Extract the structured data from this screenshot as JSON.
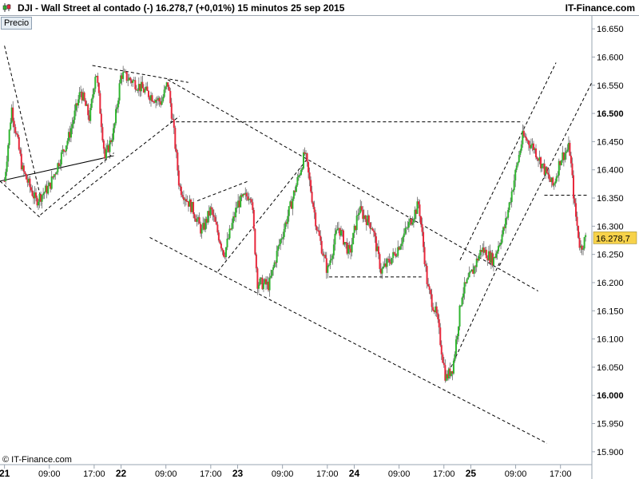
{
  "header": {
    "title": "DJI - Wall Street al contado (-)    16.278,7 (+0,01%)    15 minutos  25 sep 2015",
    "brand": "IT-Finance.com",
    "icon": "candlestick-icon"
  },
  "chart_label": "Precio",
  "watermark": "© IT-Finance.com",
  "colors": {
    "up": "#2fb52f",
    "down": "#e8283c",
    "price_tag": "#f7d24a",
    "axis": "#9aa4b0"
  },
  "chart_data": {
    "type": "candlestick",
    "interval": "15 minutos",
    "last_price_label": "16.278,7",
    "last_price": 16278.7,
    "ylim": [
      15880,
      16670
    ],
    "yticks": [
      {
        "value": 16650,
        "label": "16.650"
      },
      {
        "value": 16600,
        "label": "16.600"
      },
      {
        "value": 16550,
        "label": "16.550"
      },
      {
        "value": 16500,
        "label": "16.500",
        "bold": true
      },
      {
        "value": 16450,
        "label": "16.450"
      },
      {
        "value": 16400,
        "label": "16.400"
      },
      {
        "value": 16350,
        "label": "16.350"
      },
      {
        "value": 16300,
        "label": "16.300"
      },
      {
        "value": 16250,
        "label": "16.250"
      },
      {
        "value": 16200,
        "label": "16.200"
      },
      {
        "value": 16150,
        "label": "16.150"
      },
      {
        "value": 16100,
        "label": "16.100"
      },
      {
        "value": 16050,
        "label": "16.050"
      },
      {
        "value": 16000,
        "label": "16.000",
        "bold": true
      },
      {
        "value": 15950,
        "label": "15.950"
      },
      {
        "value": 15900,
        "label": "15.900"
      }
    ],
    "xticks": [
      {
        "t": 0,
        "label": "21",
        "bold": true
      },
      {
        "t": 0.5,
        "label": "09:00"
      },
      {
        "t": 1.0,
        "label": "17:00"
      },
      {
        "t": 1.3,
        "label": "22",
        "bold": true
      },
      {
        "t": 1.8,
        "label": "09:00"
      },
      {
        "t": 2.3,
        "label": "17:00"
      },
      {
        "t": 2.6,
        "label": "23",
        "bold": true
      },
      {
        "t": 3.1,
        "label": "09:00"
      },
      {
        "t": 3.6,
        "label": "17:00"
      },
      {
        "t": 3.9,
        "label": "24",
        "bold": true
      },
      {
        "t": 4.4,
        "label": "09:00"
      },
      {
        "t": 4.9,
        "label": "17:00"
      },
      {
        "t": 5.2,
        "label": "25",
        "bold": true
      },
      {
        "t": 5.7,
        "label": "09:00"
      },
      {
        "t": 6.2,
        "label": "17:00"
      }
    ],
    "xlim": [
      -0.05,
      6.55
    ],
    "price_path": [
      {
        "t": 0.0,
        "p": 16380
      },
      {
        "t": 0.08,
        "p": 16510
      },
      {
        "t": 0.2,
        "p": 16400
      },
      {
        "t": 0.35,
        "p": 16345
      },
      {
        "t": 0.5,
        "p": 16370
      },
      {
        "t": 0.62,
        "p": 16420
      },
      {
        "t": 0.72,
        "p": 16460
      },
      {
        "t": 0.85,
        "p": 16540
      },
      {
        "t": 0.95,
        "p": 16490
      },
      {
        "t": 1.02,
        "p": 16580
      },
      {
        "t": 1.12,
        "p": 16420
      },
      {
        "t": 1.22,
        "p": 16470
      },
      {
        "t": 1.3,
        "p": 16570
      },
      {
        "t": 1.45,
        "p": 16555
      },
      {
        "t": 1.6,
        "p": 16535
      },
      {
        "t": 1.75,
        "p": 16520
      },
      {
        "t": 1.82,
        "p": 16555
      },
      {
        "t": 1.88,
        "p": 16480
      },
      {
        "t": 1.95,
        "p": 16370
      },
      {
        "t": 2.1,
        "p": 16330
      },
      {
        "t": 2.2,
        "p": 16290
      },
      {
        "t": 2.3,
        "p": 16330
      },
      {
        "t": 2.45,
        "p": 16250
      },
      {
        "t": 2.6,
        "p": 16340
      },
      {
        "t": 2.75,
        "p": 16360
      },
      {
        "t": 2.82,
        "p": 16200
      },
      {
        "t": 2.95,
        "p": 16195
      },
      {
        "t": 3.05,
        "p": 16260
      },
      {
        "t": 3.18,
        "p": 16330
      },
      {
        "t": 3.35,
        "p": 16430
      },
      {
        "t": 3.48,
        "p": 16300
      },
      {
        "t": 3.6,
        "p": 16220
      },
      {
        "t": 3.72,
        "p": 16300
      },
      {
        "t": 3.85,
        "p": 16250
      },
      {
        "t": 3.95,
        "p": 16330
      },
      {
        "t": 4.1,
        "p": 16300
      },
      {
        "t": 4.2,
        "p": 16220
      },
      {
        "t": 4.35,
        "p": 16250
      },
      {
        "t": 4.5,
        "p": 16300
      },
      {
        "t": 4.62,
        "p": 16340
      },
      {
        "t": 4.72,
        "p": 16190
      },
      {
        "t": 4.82,
        "p": 16140
      },
      {
        "t": 4.92,
        "p": 16030
      },
      {
        "t": 5.0,
        "p": 16050
      },
      {
        "t": 5.1,
        "p": 16180
      },
      {
        "t": 5.22,
        "p": 16220
      },
      {
        "t": 5.32,
        "p": 16260
      },
      {
        "t": 5.45,
        "p": 16240
      },
      {
        "t": 5.58,
        "p": 16300
      },
      {
        "t": 5.68,
        "p": 16380
      },
      {
        "t": 5.78,
        "p": 16460
      },
      {
        "t": 5.9,
        "p": 16440
      },
      {
        "t": 6.02,
        "p": 16400
      },
      {
        "t": 6.12,
        "p": 16370
      },
      {
        "t": 6.2,
        "p": 16420
      },
      {
        "t": 6.3,
        "p": 16440
      },
      {
        "t": 6.36,
        "p": 16330
      },
      {
        "t": 6.42,
        "p": 16260
      },
      {
        "t": 6.48,
        "p": 16278.7
      }
    ],
    "trendlines": [
      {
        "from": [
          0.0,
          16620
        ],
        "to": [
          0.42,
          16340
        ],
        "style": "dashed"
      },
      {
        "from": [
          -0.05,
          16380
        ],
        "to": [
          0.4,
          16315
        ],
        "style": "dashed"
      },
      {
        "from": [
          0.4,
          16320
        ],
        "to": [
          1.22,
          16430
        ],
        "style": "dashed"
      },
      {
        "from": [
          -0.05,
          16380
        ],
        "to": [
          1.22,
          16425
        ],
        "style": "solid"
      },
      {
        "from": [
          0.98,
          16585
        ],
        "to": [
          2.05,
          16555
        ],
        "style": "dashed"
      },
      {
        "from": [
          0.62,
          16330
        ],
        "to": [
          1.95,
          16495
        ],
        "style": "dashed"
      },
      {
        "from": [
          1.82,
          16560
        ],
        "to": [
          5.95,
          16185
        ],
        "style": "dashed"
      },
      {
        "from": [
          1.85,
          16485
        ],
        "to": [
          5.78,
          16485
        ],
        "style": "dashed"
      },
      {
        "from": [
          2.15,
          16345
        ],
        "to": [
          2.72,
          16380
        ],
        "style": "dashed"
      },
      {
        "from": [
          2.38,
          16220
        ],
        "to": [
          3.38,
          16420
        ],
        "style": "dashed"
      },
      {
        "from": [
          1.62,
          16280
        ],
        "to": [
          6.05,
          15915
        ],
        "style": "dashed"
      },
      {
        "from": [
          3.62,
          16210
        ],
        "to": [
          4.65,
          16210
        ],
        "style": "dashed"
      },
      {
        "from": [
          4.98,
          16050
        ],
        "to": [
          5.52,
          16235
        ],
        "style": "dashed"
      },
      {
        "from": [
          5.52,
          16230
        ],
        "to": [
          6.55,
          16555
        ],
        "style": "dashed"
      },
      {
        "from": [
          5.08,
          16240
        ],
        "to": [
          6.15,
          16590
        ],
        "style": "dashed"
      },
      {
        "from": [
          6.02,
          16355
        ],
        "to": [
          6.5,
          16355
        ],
        "style": "dashed"
      }
    ]
  }
}
